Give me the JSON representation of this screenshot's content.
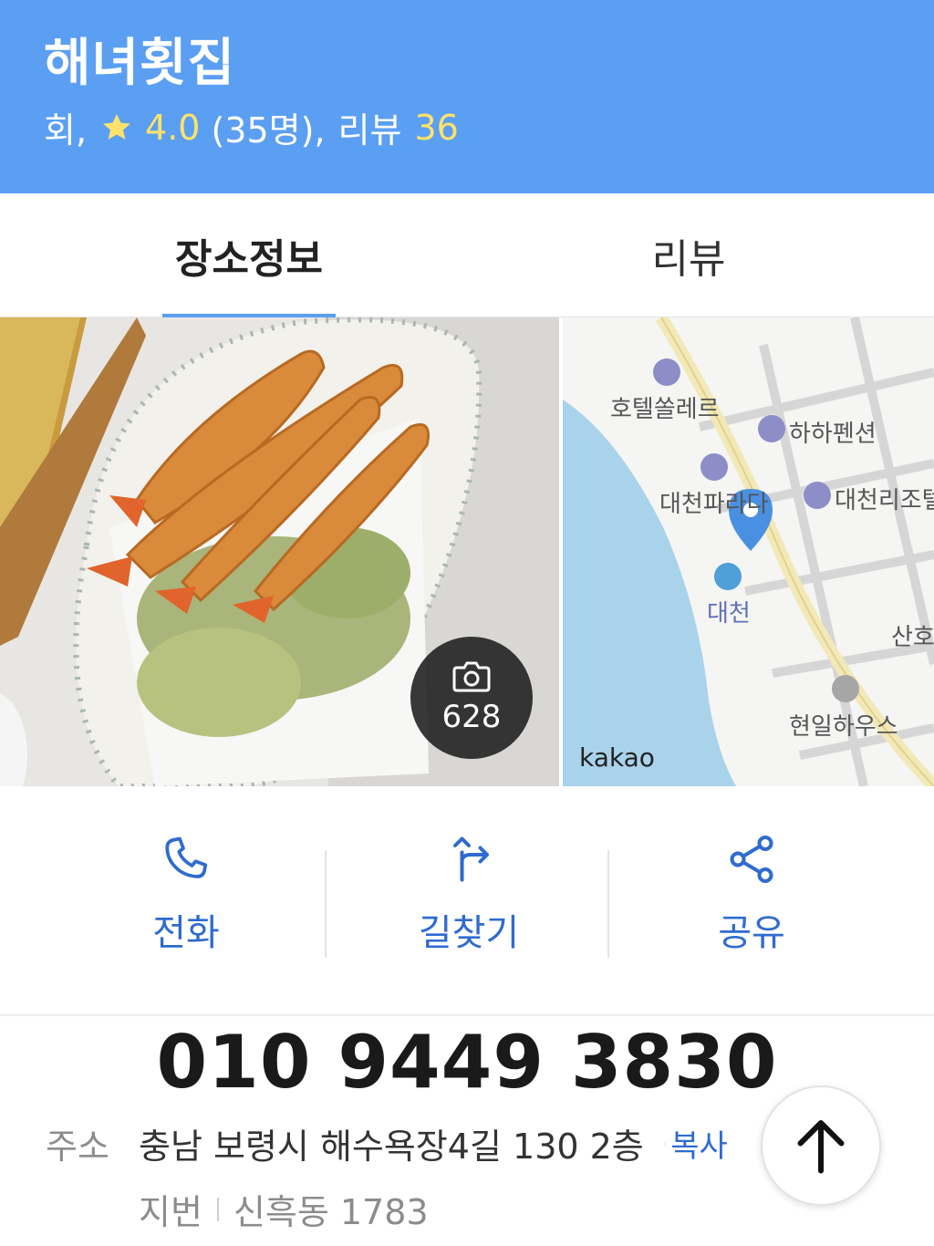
{
  "place": {
    "name": "해녀횟집",
    "category": "회,",
    "rating": "4.0",
    "rating_count": "(35명),",
    "review_label": "리뷰",
    "review_count": "36"
  },
  "tabs": [
    {
      "label": "장소정보",
      "active": true
    },
    {
      "label": "리뷰",
      "active": false
    }
  ],
  "photo": {
    "count": "628"
  },
  "map": {
    "labels": {
      "hotel_solere": "호텔쏠레르",
      "haha_pension": "하하펜션",
      "daecheon_para": "대천파라다",
      "daecheonri_condo": "대천리조텔",
      "daecheon": "대천",
      "sanho": "산호",
      "hyunil_house": "현일하우스"
    },
    "brand": "kakao"
  },
  "actions": {
    "call": "전화",
    "directions": "길찾기",
    "share": "공유"
  },
  "contact": {
    "phone": "010 9449 3830",
    "address_label": "주소",
    "address": "충남 보령시 해수욕장4길 130 2층",
    "copy_label": "복사",
    "lot_label": "지번",
    "lot_value": "신흑동 1783"
  },
  "colors": {
    "header_bg": "#5b9ff2",
    "accent_blue": "#2f6bd0",
    "rating_yellow": "#ffe26a"
  }
}
